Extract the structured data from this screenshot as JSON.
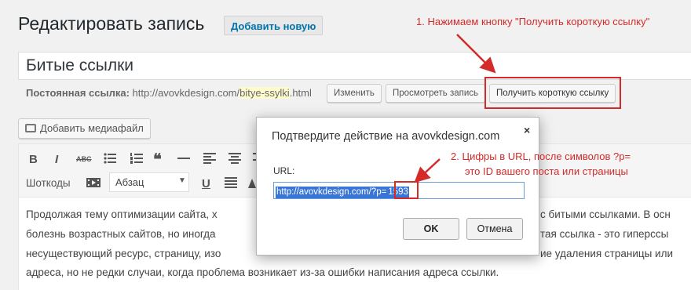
{
  "header": {
    "title": "Редактировать запись",
    "add_new": "Добавить новую"
  },
  "post": {
    "title": "Битые ссылки"
  },
  "permalink": {
    "label": "Постоянная ссылка:",
    "url_prefix": "http://avovkdesign.com/",
    "slug": "bitye-ssylki",
    "url_suffix": ".html",
    "btn_edit": "Изменить",
    "btn_view": "Просмотреть запись",
    "btn_shortlink": "Получить короткую ссылку"
  },
  "annotations": {
    "step1": "1. Нажимаем кнопку \"Получить короткую ссылку\"",
    "step2_line1": "2. Цифры в URL, после символов ?p=",
    "step2_line2": "это ID вашего поста или страницы"
  },
  "media": {
    "label": "Добавить медиафайл"
  },
  "toolbar": {
    "bold": "B",
    "italic": "I",
    "strike": "ABC",
    "quote": "❝",
    "shortcodes": "Шоткоды",
    "format": "Абзац",
    "underline": "U"
  },
  "content": {
    "line1": "Продолжая тему оптимизации сайта, х",
    "line1_end": "с битыми ссылками. В осн",
    "line2": "болезнь возрастных сайтов, но иногда",
    "line2_end": "тая ссылка - это гиперссы",
    "line3": "несуществующий ресурс, страницу, изо",
    "line3_end": "ие удаления страницы или",
    "line4": "адреса, но не редки случаи,  когда проблема возникает из-за ошибки написания адреса ссылки."
  },
  "dialog": {
    "title": "Подтвердите действие на avovkdesign.com",
    "close": "×",
    "url_label": "URL:",
    "url_value_prefix": "http://avovkdesign.com/?p=",
    "url_value_id": "1593",
    "ok": "OK",
    "cancel": "Отмена"
  }
}
